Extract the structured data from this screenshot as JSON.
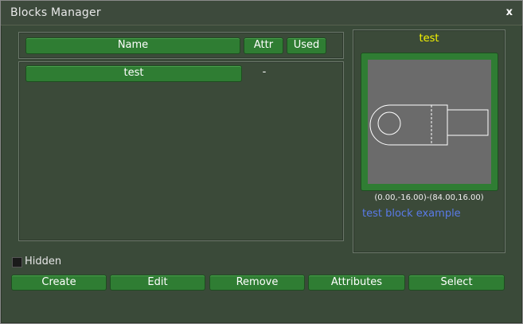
{
  "window": {
    "title": "Blocks Manager",
    "close_label": "x"
  },
  "table": {
    "headers": {
      "name": "Name",
      "attr": "Attr",
      "used": "Used"
    },
    "rows": [
      {
        "name": "test",
        "attr": "",
        "used": "-"
      }
    ]
  },
  "preview": {
    "block_name": "test",
    "bounds": "(0.00,-16.00)-(84.00,16.00)",
    "description": "test block example"
  },
  "hidden_checkbox": {
    "label": "Hidden",
    "checked": false
  },
  "buttons": {
    "create": "Create",
    "edit": "Edit",
    "remove": "Remove",
    "attributes": "Attributes",
    "select": "Select"
  },
  "colors": {
    "accent_green": "#2f7d33",
    "preview_name": "#f4f400",
    "description": "#5a7ae8",
    "preview_bg": "#6b6b6b"
  }
}
